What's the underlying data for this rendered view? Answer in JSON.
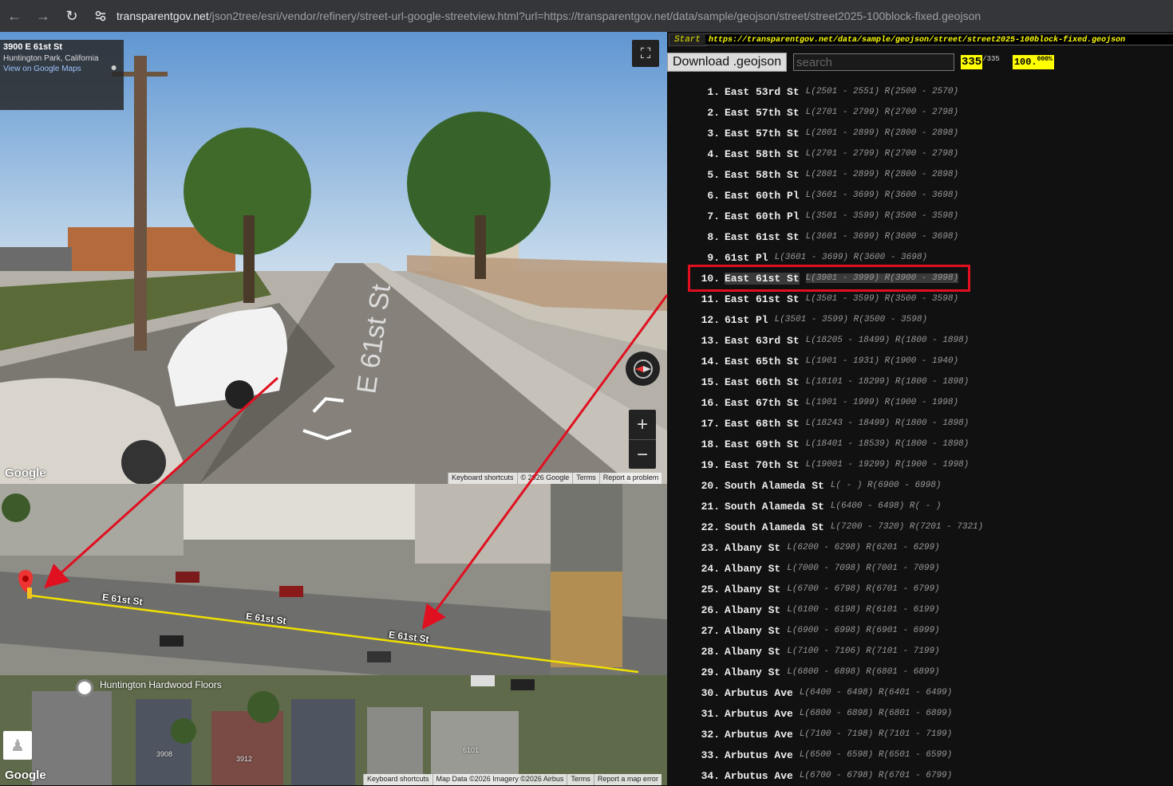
{
  "browser": {
    "url_host": "transparentgov.net",
    "url_path": "/json2tree/esri/vendor/refinery/street-url-google-streetview.html?url=https://transparentgov.net/data/sample/geojson/street/street2025-100block-fixed.geojson"
  },
  "streetview": {
    "address": "3900 E 61st St",
    "city": "Huntington Park, California",
    "view_link": "View on Google Maps",
    "road_marking": "E 61st St",
    "logo": "Google",
    "footer": [
      "Keyboard shortcuts",
      "© 2026 Google",
      "Terms",
      "Report a problem"
    ]
  },
  "map": {
    "street_labels": [
      "E 61st St",
      "E 61st St",
      "E 61st St"
    ],
    "poi": "Huntington Hardwood Floors",
    "house_numbers": [
      "3908",
      "3912",
      "6101"
    ],
    "logo": "Google",
    "footer": [
      "Keyboard shortcuts",
      "Map Data ©2026 Imagery ©2026 Airbus",
      "Terms",
      "Report a map error"
    ],
    "route_color": "#f0e000"
  },
  "panel": {
    "start_label": "Start",
    "source_url": "https://transparentgov.net/data/sample/geojson/street/street2025-100block-fixed.geojson",
    "download_label": "Download .geojson",
    "search_placeholder": "search",
    "count_current": "335",
    "count_total": "/335",
    "percent": "100.",
    "percent_frac": "000%",
    "selected_index": 10,
    "items": [
      {
        "num": "1.",
        "name": "East 53rd St",
        "range": "L(2501 - 2551) R(2500 - 2570)"
      },
      {
        "num": "2.",
        "name": "East 57th St",
        "range": "L(2701 - 2799) R(2700 - 2798)"
      },
      {
        "num": "3.",
        "name": "East 57th St",
        "range": "L(2801 - 2899) R(2800 - 2898)"
      },
      {
        "num": "4.",
        "name": "East 58th St",
        "range": "L(2701 - 2799) R(2700 - 2798)"
      },
      {
        "num": "5.",
        "name": "East 58th St",
        "range": "L(2801 - 2899) R(2800 - 2898)"
      },
      {
        "num": "6.",
        "name": "East 60th Pl",
        "range": "L(3601 - 3699) R(3600 - 3698)"
      },
      {
        "num": "7.",
        "name": "East 60th Pl",
        "range": "L(3501 - 3599) R(3500 - 3598)"
      },
      {
        "num": "8.",
        "name": "East 61st St",
        "range": "L(3601 - 3699) R(3600 - 3698)"
      },
      {
        "num": "9.",
        "name": "61st Pl",
        "range": "L(3601 - 3699) R(3600 - 3698)"
      },
      {
        "num": "10.",
        "name": "East 61st St",
        "range": "L(3901 - 3999) R(3900 - 3998)"
      },
      {
        "num": "11.",
        "name": "East 61st St",
        "range": "L(3501 - 3599) R(3500 - 3598)"
      },
      {
        "num": "12.",
        "name": "61st Pl",
        "range": "L(3501 - 3599) R(3500 - 3598)"
      },
      {
        "num": "13.",
        "name": "East 63rd St",
        "range": "L(18205 - 18499) R(1800 - 1898)"
      },
      {
        "num": "14.",
        "name": "East 65th St",
        "range": "L(1901 - 1931) R(1900 - 1940)"
      },
      {
        "num": "15.",
        "name": "East 66th St",
        "range": "L(18101 - 18299) R(1800 - 1898)"
      },
      {
        "num": "16.",
        "name": "East 67th St",
        "range": "L(1901 - 1999) R(1900 - 1998)"
      },
      {
        "num": "17.",
        "name": "East 68th St",
        "range": "L(18243 - 18499) R(1800 - 1898)"
      },
      {
        "num": "18.",
        "name": "East 69th St",
        "range": "L(18401 - 18539) R(1800 - 1898)"
      },
      {
        "num": "19.",
        "name": "East 70th St",
        "range": "L(19001 - 19299) R(1900 - 1998)"
      },
      {
        "num": "20.",
        "name": "South Alameda St",
        "range": "L( - ) R(6900 - 6998)"
      },
      {
        "num": "21.",
        "name": "South Alameda St",
        "range": "L(6400 - 6498) R( - )"
      },
      {
        "num": "22.",
        "name": "South Alameda St",
        "range": "L(7200 - 7320) R(7201 - 7321)"
      },
      {
        "num": "23.",
        "name": "Albany St",
        "range": "L(6200 - 6298) R(6201 - 6299)"
      },
      {
        "num": "24.",
        "name": "Albany St",
        "range": "L(7000 - 7098) R(7001 - 7099)"
      },
      {
        "num": "25.",
        "name": "Albany St",
        "range": "L(6700 - 6798) R(6701 - 6799)"
      },
      {
        "num": "26.",
        "name": "Albany St",
        "range": "L(6100 - 6198) R(6101 - 6199)"
      },
      {
        "num": "27.",
        "name": "Albany St",
        "range": "L(6900 - 6998) R(6901 - 6999)"
      },
      {
        "num": "28.",
        "name": "Albany St",
        "range": "L(7100 - 7106) R(7101 - 7199)"
      },
      {
        "num": "29.",
        "name": "Albany St",
        "range": "L(6800 - 6898) R(6801 - 6899)"
      },
      {
        "num": "30.",
        "name": "Arbutus Ave",
        "range": "L(6400 - 6498) R(6401 - 6499)"
      },
      {
        "num": "31.",
        "name": "Arbutus Ave",
        "range": "L(6800 - 6898) R(6801 - 6899)"
      },
      {
        "num": "32.",
        "name": "Arbutus Ave",
        "range": "L(7100 - 7198) R(7101 - 7199)"
      },
      {
        "num": "33.",
        "name": "Arbutus Ave",
        "range": "L(6500 - 6598) R(6501 - 6599)"
      },
      {
        "num": "34.",
        "name": "Arbutus Ave",
        "range": "L(6700 - 6798) R(6701 - 6799)"
      }
    ]
  },
  "colors": {
    "highlight_box": "#e01020",
    "annotation_arrow": "#e01020",
    "accent_yellow": "#ffff00"
  }
}
